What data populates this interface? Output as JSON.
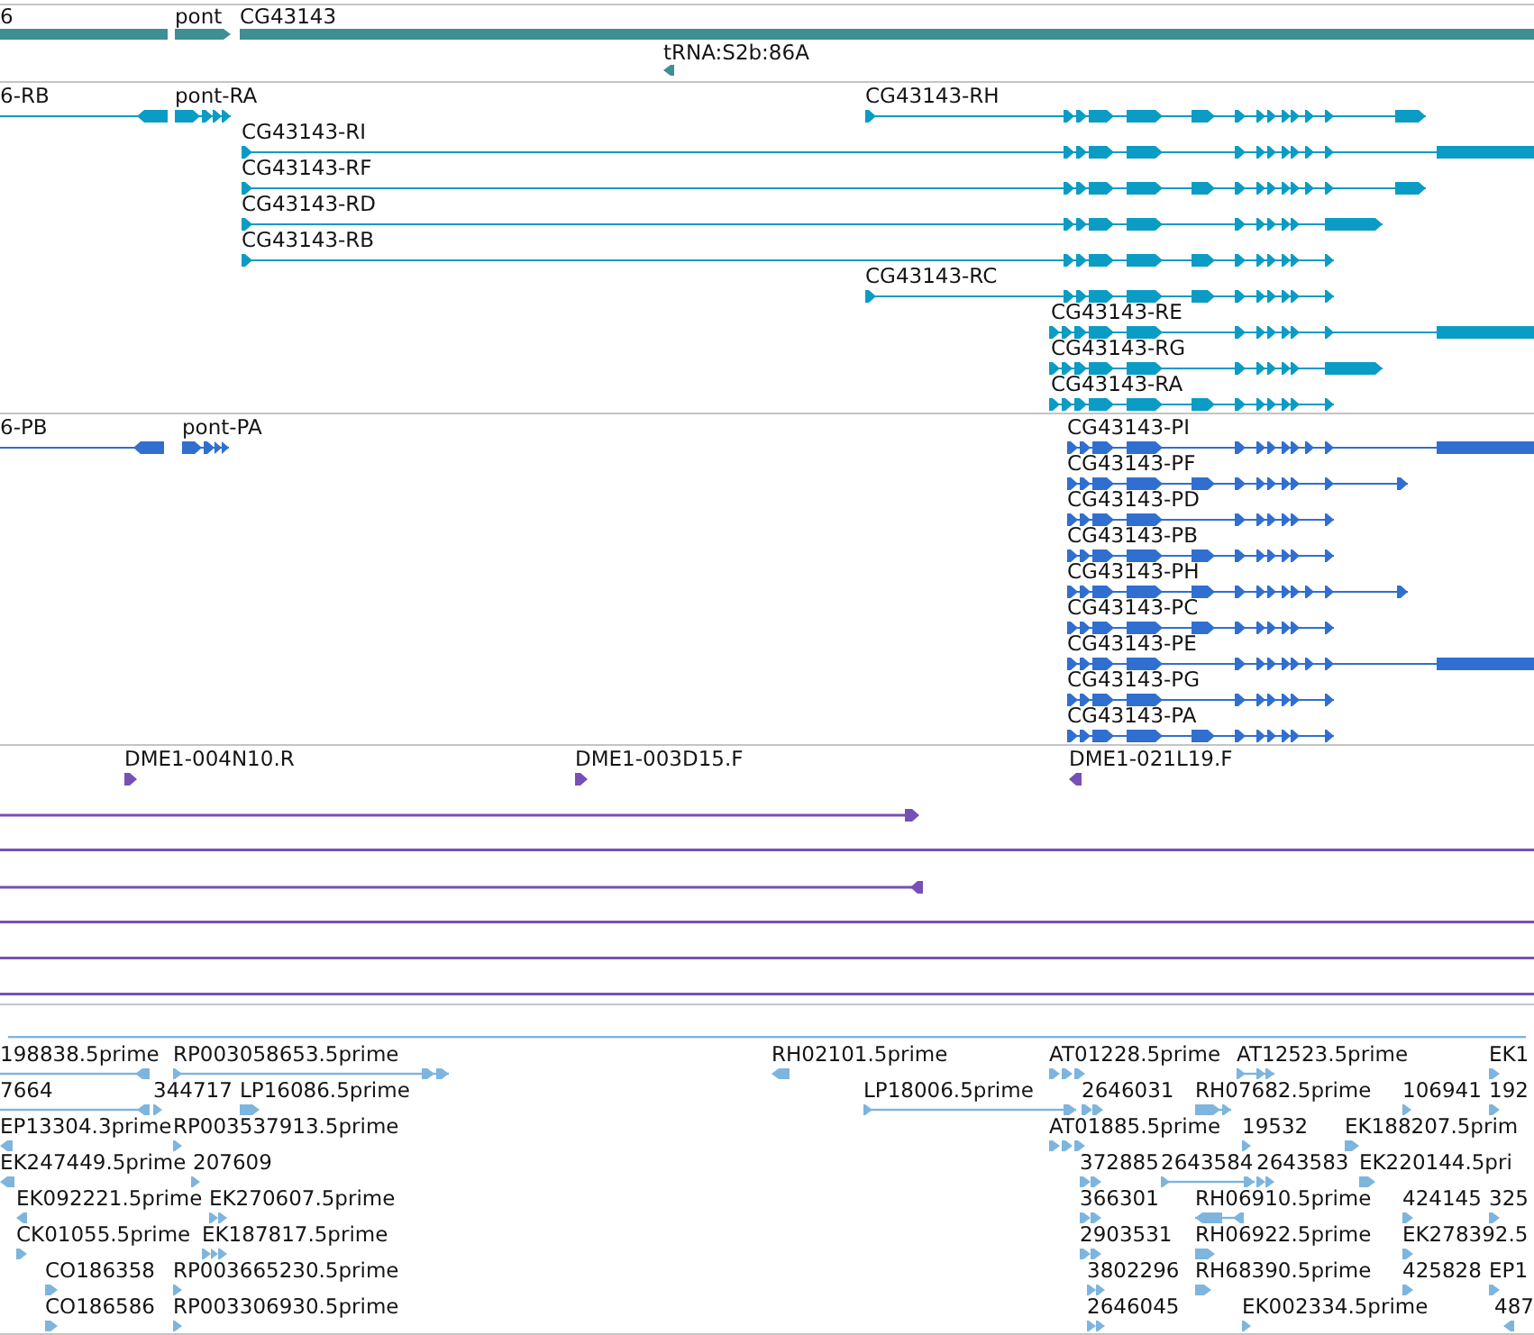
{
  "tracks": [
    {
      "kind": "gene",
      "features": [
        {
          "label": "6"
        },
        {
          "label": "pont"
        },
        {
          "label": "CG43143"
        },
        {
          "label": "tRNA:S2b:86A"
        }
      ]
    },
    {
      "kind": "transcript",
      "features": [
        {
          "label": "6-RB"
        },
        {
          "label": "pont-RA"
        },
        {
          "label": "CG43143-RH"
        },
        {
          "label": "CG43143-RI"
        },
        {
          "label": "CG43143-RF"
        },
        {
          "label": "CG43143-RD"
        },
        {
          "label": "CG43143-RB"
        },
        {
          "label": "CG43143-RC"
        },
        {
          "label": "CG43143-RE"
        },
        {
          "label": "CG43143-RG"
        },
        {
          "label": "CG43143-RA"
        }
      ]
    },
    {
      "kind": "protein",
      "features": [
        {
          "label": "6-PB"
        },
        {
          "label": "pont-PA"
        },
        {
          "label": "CG43143-PI"
        },
        {
          "label": "CG43143-PF"
        },
        {
          "label": "CG43143-PD"
        },
        {
          "label": "CG43143-PB"
        },
        {
          "label": "CG43143-PH"
        },
        {
          "label": "CG43143-PC"
        },
        {
          "label": "CG43143-PE"
        },
        {
          "label": "CG43143-PG"
        },
        {
          "label": "CG43143-PA"
        }
      ]
    },
    {
      "kind": "clone",
      "features": [
        {
          "label": "DME1-004N10.R"
        },
        {
          "label": "DME1-003D15.F"
        },
        {
          "label": "DME1-021L19.F"
        }
      ]
    },
    {
      "kind": "est",
      "features": [
        {
          "label": "198838.5prime"
        },
        {
          "label": "RP003058653.5prime"
        },
        {
          "label": "RH02101.5prime"
        },
        {
          "label": "AT01228.5prime"
        },
        {
          "label": "AT12523.5prime"
        },
        {
          "label": "EK1"
        },
        {
          "label": "7664"
        },
        {
          "label": "344717"
        },
        {
          "label": "LP16086.5prime"
        },
        {
          "label": "LP18006.5prime"
        },
        {
          "label": "2646031"
        },
        {
          "label": "RH07682.5prime"
        },
        {
          "label": "106941"
        },
        {
          "label": "192"
        },
        {
          "label": "EP13304.3prime"
        },
        {
          "label": "RP003537913.5prime"
        },
        {
          "label": "AT01885.5prime"
        },
        {
          "label": "19532"
        },
        {
          "label": "EK188207.5prim"
        },
        {
          "label": "EK247449.5prime"
        },
        {
          "label": "207609"
        },
        {
          "label": "372885"
        },
        {
          "label": "2643584"
        },
        {
          "label": "2643583"
        },
        {
          "label": "EK220144.5pri"
        },
        {
          "label": "EK092221.5prime"
        },
        {
          "label": "EK270607.5prime"
        },
        {
          "label": "366301"
        },
        {
          "label": "RH06910.5prime"
        },
        {
          "label": "424145"
        },
        {
          "label": "325"
        },
        {
          "label": "CK01055.5prime"
        },
        {
          "label": "EK187817.5prime"
        },
        {
          "label": "2903531"
        },
        {
          "label": "RH06922.5prime"
        },
        {
          "label": "EK278392.5"
        },
        {
          "label": "CO186358"
        },
        {
          "label": "RP003665230.5prime"
        },
        {
          "label": "3802296"
        },
        {
          "label": "RH68390.5prime"
        },
        {
          "label": "425828"
        },
        {
          "label": "EP1"
        },
        {
          "label": "CO186586"
        },
        {
          "label": "RP003306930.5prime"
        },
        {
          "label": "2646045"
        },
        {
          "label": "EK002334.5prime"
        },
        {
          "label": "487"
        }
      ]
    }
  ]
}
